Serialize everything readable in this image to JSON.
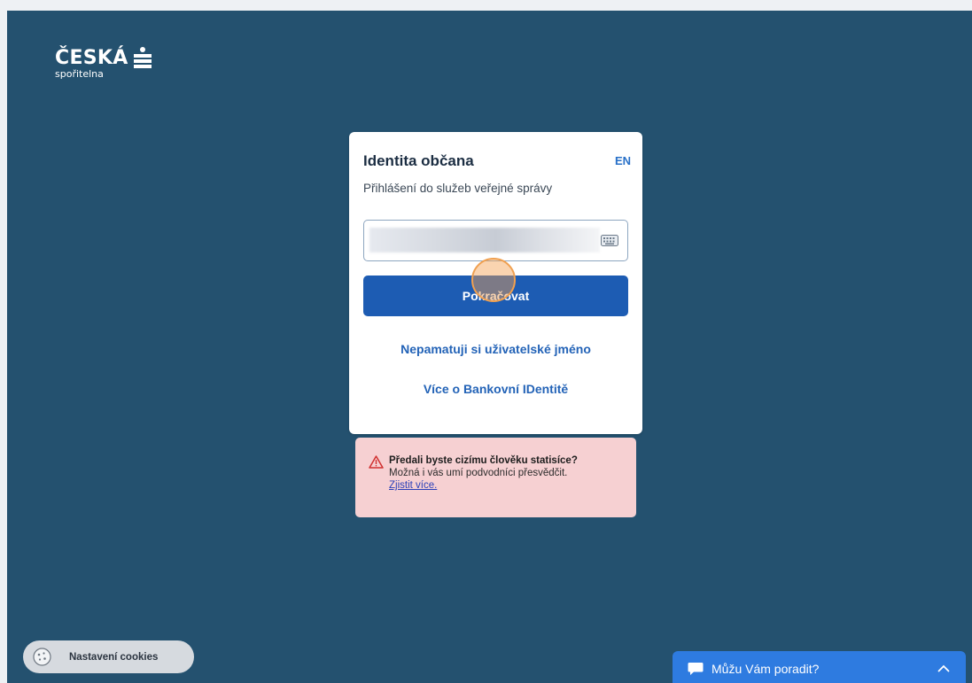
{
  "logo": {
    "name": "ČESKÁ",
    "subtitle": "spořitelna"
  },
  "login_card": {
    "title": "Identita občana",
    "language_link": "EN",
    "subtitle": "Přihlášení do služeb veřejné správy",
    "username_value": "",
    "continue_label": "Pokračovat",
    "forgot_username_link": "Nepamatuji si uživatelské jméno",
    "more_info_link": "Více o Bankovní IDentitě"
  },
  "warning": {
    "title": "Předali byste cizímu člověku statisíce?",
    "body": "Možná i vás umí podvodníci přesvědčit.",
    "link": "Zjistit více."
  },
  "cookies": {
    "label": "Nastavení cookies"
  },
  "chat": {
    "label": "Můžu Vám poradit?"
  },
  "colors": {
    "background": "#24516f",
    "primary_button": "#1d5cb3",
    "link": "#2363b7",
    "warning_bg": "#f6d0d2",
    "chat_bar": "#2e7be0"
  },
  "icons": [
    "bank-logo-icon",
    "keyboard-icon",
    "warning-icon",
    "cookie-icon",
    "chat-bubble-icon",
    "chevron-up-icon"
  ]
}
